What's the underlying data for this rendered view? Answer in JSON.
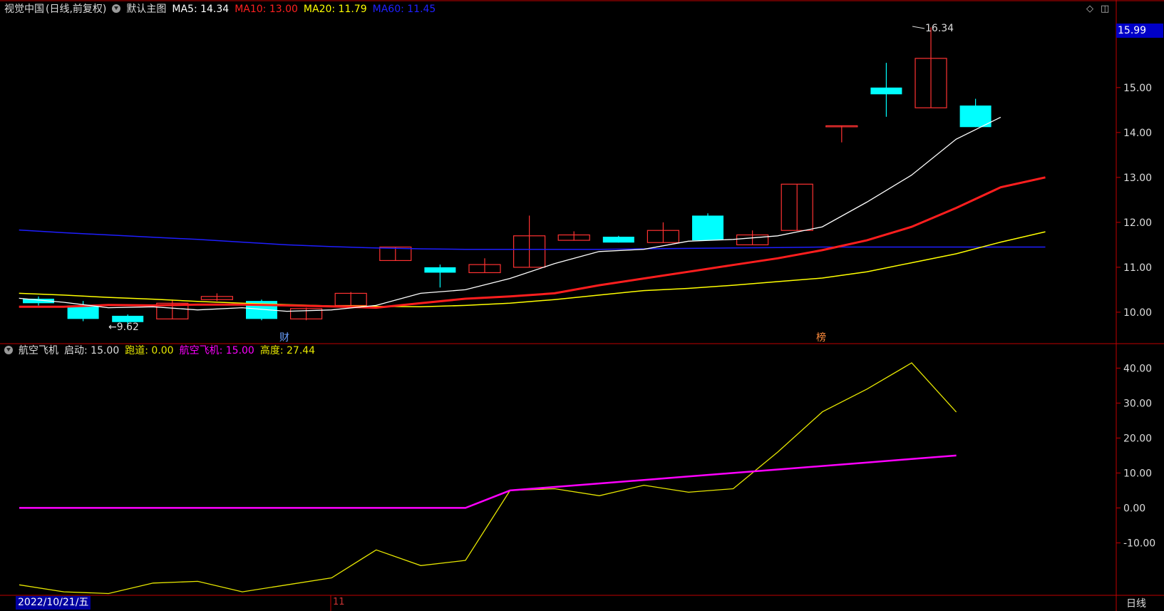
{
  "header_main": {
    "name": "视觉中国",
    "mode": "(日线,前复权)",
    "template": "默认主图",
    "ma5": "MA5: 14.34",
    "ma10": "MA10: 13.00",
    "ma20": "MA20: 11.79",
    "ma60": "MA60: 11.45"
  },
  "header_sub": {
    "name": "航空飞机",
    "start": "启动: 15.00",
    "runway": "跑道: 0.00",
    "plane": "航空飞机: 15.00",
    "height": "高度: 27.44"
  },
  "last_price": "15.99",
  "date_label": "2022/10/21/五",
  "period_label": "日线",
  "month_label": "11",
  "colors": {
    "up": "#ff3232",
    "down": "#00ffff",
    "ma5": "#ffffff",
    "ma10": "#ff1e1e",
    "ma20": "#ffff00",
    "ma60": "#1e1eff",
    "sub_yellow": "#e6e600",
    "sub_magenta": "#ff00ff",
    "axis": "#c00000"
  },
  "chart_data": [
    {
      "type": "candlestick",
      "ylim": [
        9.3,
        16.6
      ],
      "yticks": [
        "15.00",
        "14.00",
        "13.00",
        "12.00",
        "11.00",
        "10.00"
      ],
      "candles": [
        {
          "o": 10.3,
          "c": 10.2,
          "h": 10.35,
          "l": 10.15
        },
        {
          "o": 10.15,
          "c": 9.85,
          "h": 10.25,
          "l": 9.8
        },
        {
          "o": 9.92,
          "c": 9.78,
          "h": 9.95,
          "l": 9.62
        },
        {
          "o": 9.85,
          "c": 10.2,
          "h": 10.28,
          "l": 9.85
        },
        {
          "o": 10.28,
          "c": 10.35,
          "h": 10.42,
          "l": 10.25
        },
        {
          "o": 10.25,
          "c": 9.85,
          "h": 10.28,
          "l": 9.82
        },
        {
          "o": 9.85,
          "c": 10.08,
          "h": 10.1,
          "l": 9.82
        },
        {
          "o": 10.15,
          "c": 10.42,
          "h": 10.45,
          "l": 10.1
        },
        {
          "o": 11.15,
          "c": 11.45,
          "h": 11.45,
          "l": 11.15
        },
        {
          "o": 11.0,
          "c": 10.88,
          "h": 11.06,
          "l": 10.55
        },
        {
          "o": 10.88,
          "c": 11.06,
          "h": 11.2,
          "l": 10.88
        },
        {
          "o": 11.0,
          "c": 11.7,
          "h": 12.15,
          "l": 11.0
        },
        {
          "o": 11.6,
          "c": 11.72,
          "h": 11.8,
          "l": 11.6
        },
        {
          "o": 11.68,
          "c": 11.55,
          "h": 11.7,
          "l": 11.55
        },
        {
          "o": 11.55,
          "c": 11.82,
          "h": 12.0,
          "l": 11.55
        },
        {
          "o": 12.15,
          "c": 11.6,
          "h": 12.2,
          "l": 11.6
        },
        {
          "o": 11.5,
          "c": 11.72,
          "h": 11.82,
          "l": 11.5
        },
        {
          "o": 11.82,
          "c": 12.85,
          "h": 12.85,
          "l": 11.82
        },
        {
          "o": 14.15,
          "c": 14.15,
          "h": 14.15,
          "l": 13.78
        },
        {
          "o": 15.0,
          "c": 14.85,
          "h": 15.55,
          "l": 14.35
        },
        {
          "o": 14.55,
          "c": 15.65,
          "h": 16.34,
          "l": 14.55
        },
        {
          "o": 14.6,
          "c": 14.12,
          "h": 14.75,
          "l": 14.12
        }
      ],
      "ma5": [
        10.31,
        10.22,
        10.1,
        10.12,
        10.05,
        10.1,
        10.02,
        10.05,
        10.15,
        10.42,
        10.5,
        10.75,
        11.08,
        11.35,
        11.4,
        11.58,
        11.62,
        11.7,
        11.9,
        12.45,
        13.05,
        13.85,
        14.34
      ],
      "ma10": [
        10.12,
        10.12,
        10.16,
        10.15,
        10.17,
        10.17,
        10.15,
        10.13,
        10.1,
        10.2,
        10.3,
        10.35,
        10.42,
        10.6,
        10.75,
        10.9,
        11.05,
        11.2,
        11.38,
        11.6,
        11.9,
        12.32,
        12.78,
        13.0
      ],
      "ma20": [
        10.42,
        10.38,
        10.33,
        10.29,
        10.24,
        10.2,
        10.17,
        10.14,
        10.13,
        10.12,
        10.15,
        10.2,
        10.28,
        10.38,
        10.48,
        10.53,
        10.6,
        10.68,
        10.76,
        10.9,
        11.1,
        11.3,
        11.56,
        11.79
      ],
      "ma60": [
        11.83,
        11.77,
        11.72,
        11.67,
        11.62,
        11.56,
        11.5,
        11.46,
        11.43,
        11.41,
        11.4,
        11.4,
        11.4,
        11.4,
        11.41,
        11.42,
        11.43,
        11.44,
        11.45,
        11.45,
        11.45,
        11.45,
        11.45,
        11.45
      ],
      "annotations": [
        "←9.62",
        "16.34",
        "财",
        "榜"
      ]
    },
    {
      "type": "line",
      "ylim": [
        -25,
        47
      ],
      "yticks": [
        "40.00",
        "30.00",
        "20.00",
        "10.00",
        "0.00",
        "-10.00"
      ],
      "series": [
        {
          "name": "高度",
          "values": [
            -22,
            -24,
            -24.5,
            -21.5,
            -21,
            -24,
            -22,
            -20,
            -12,
            -16.5,
            -15,
            5,
            5.5,
            3.5,
            6.5,
            4.5,
            5.5,
            16,
            27.5,
            34,
            41.5,
            27.44
          ]
        },
        {
          "name": "航空飞机",
          "values": [
            0,
            0,
            0,
            0,
            0,
            0,
            0,
            0,
            0,
            0,
            0,
            5,
            6,
            7,
            8,
            9,
            10,
            11,
            12,
            13,
            14,
            15
          ]
        }
      ]
    }
  ]
}
